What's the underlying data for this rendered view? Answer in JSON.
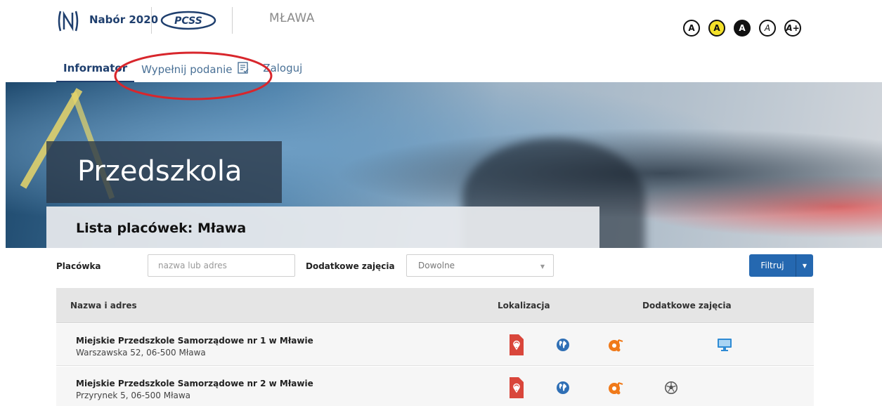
{
  "header": {
    "brand_title": "Nabór 2020",
    "partner_logo_text": "PCSS",
    "city": "MŁAWA",
    "contrast_options": [
      "A",
      "A",
      "A",
      "A",
      "A+"
    ]
  },
  "nav": {
    "items": [
      {
        "label": "Informator",
        "active": true
      },
      {
        "label": "Wypełnij podanie",
        "active": false
      },
      {
        "label": "Zaloguj",
        "active": false
      }
    ]
  },
  "hero": {
    "title": "Przedszkola",
    "subtitle": "Lista placówek: Mława"
  },
  "filters": {
    "placowka_label": "Placówka",
    "search_placeholder": "nazwa lub adres",
    "zajecia_label": "Dodatkowe zajęcia",
    "zajecia_value": "Dowolne",
    "filter_button": "Filtruj"
  },
  "table": {
    "headers": {
      "name": "Nazwa i adres",
      "location": "Lokalizacja",
      "extra": "Dodatkowe zajęcia"
    },
    "rows": [
      {
        "name": "Miejskie Przedszkole Samorządowe nr 1 w Mławie",
        "address": "Warszawska 52, 06-500 Mława",
        "icons": [
          "map-pin-icon",
          "globe-icon",
          "music-icon",
          "computer-icon"
        ]
      },
      {
        "name": "Miejskie Przedszkole Samorządowe nr 2 w Mławie",
        "address": "Przyrynek 5, 06-500 Mława",
        "icons": [
          "map-pin-icon",
          "globe-icon",
          "music-icon",
          "football-icon"
        ]
      }
    ]
  },
  "colors": {
    "primary": "#1f3f6e",
    "button": "#2568b0",
    "highlight_ellipse": "#d8262c",
    "map_pin": "#d9463b",
    "music": "#f07a1a"
  }
}
